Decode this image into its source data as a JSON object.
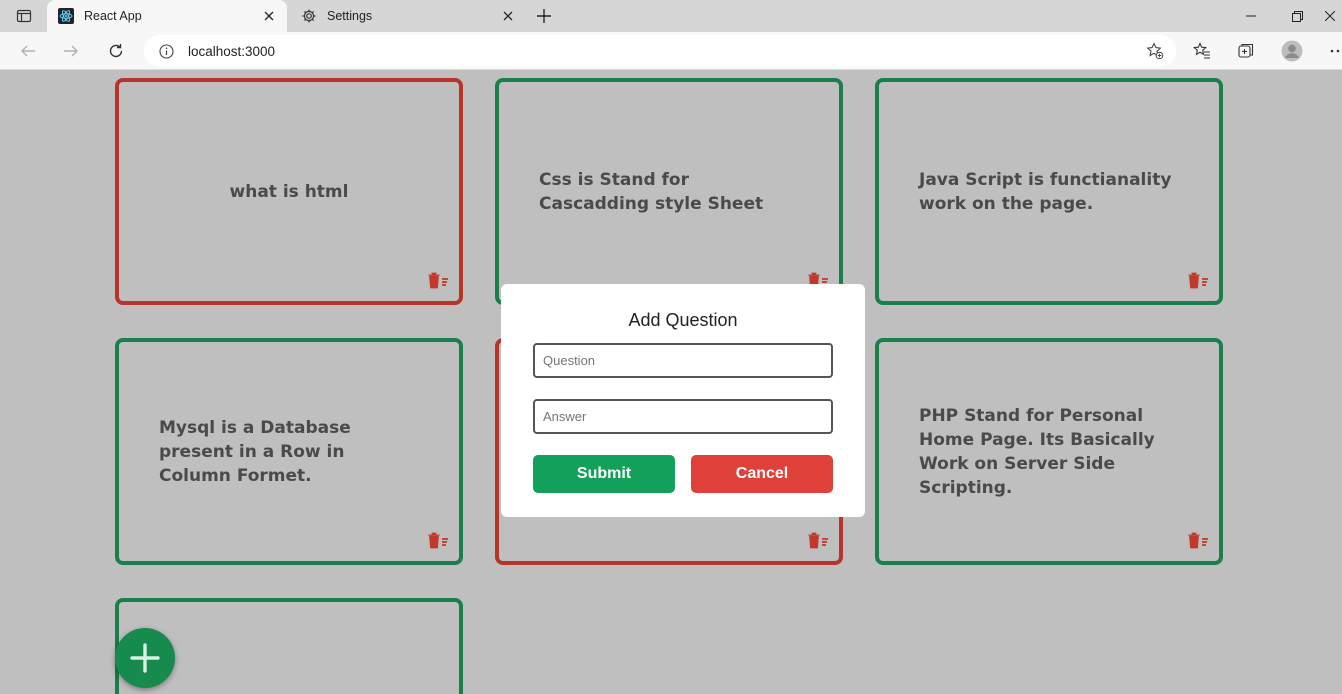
{
  "browser": {
    "tabs": [
      {
        "label": "React App",
        "active": true,
        "icon": "react-icon"
      },
      {
        "label": "Settings",
        "active": false,
        "icon": "gear-icon"
      }
    ],
    "url": "localhost:3000"
  },
  "cards": [
    {
      "text": "what is html",
      "status": "red"
    },
    {
      "text": "Css is Stand for Cascadding style Sheet",
      "status": "green"
    },
    {
      "text": "Java Script is functianality work on the page.",
      "status": "green"
    },
    {
      "text": "Mysql is a Database present in a Row in Column Formet.",
      "status": "green"
    },
    {
      "text": "",
      "status": "red"
    },
    {
      "text": "PHP Stand for Personal Home Page. Its Basically Work on Server Side Scripting.",
      "status": "green"
    },
    {
      "text": "",
      "status": "green"
    }
  ],
  "modal": {
    "title": "Add Question",
    "question_placeholder": "Question",
    "question_value": "",
    "answer_placeholder": "Answer",
    "answer_value": "",
    "submit_label": "Submit",
    "cancel_label": "Cancel"
  },
  "colors": {
    "correct_border": "#1a7f4a",
    "wrong_border": "#b5352b",
    "submit": "#12a05a",
    "cancel": "#e0403a",
    "fab": "#178a4e"
  }
}
